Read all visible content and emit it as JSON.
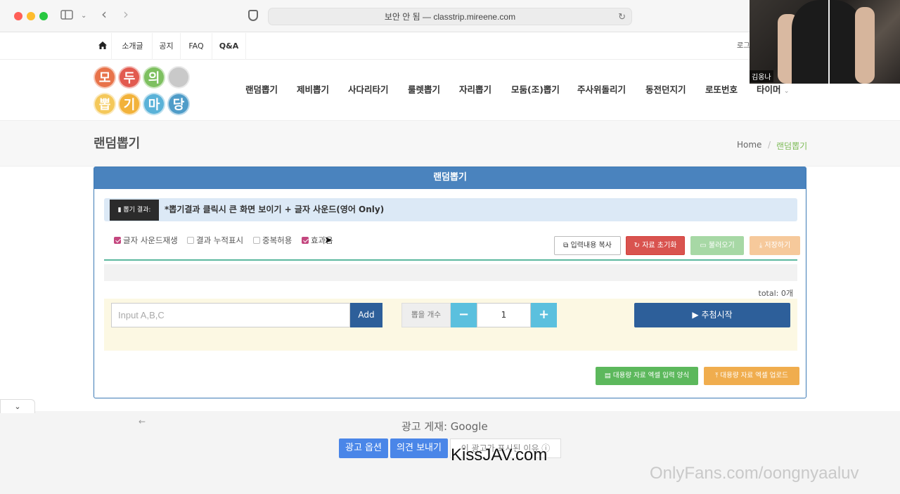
{
  "browser": {
    "url_text": "보안 안 됨 — classtrip.mireene.com",
    "sidebar_icon": "sidebar-icon",
    "back_icon": "‹",
    "forward_icon": "›",
    "reload_icon": "↻"
  },
  "webcam": {
    "name": "김옹나"
  },
  "topnav": {
    "items": [
      "소개글",
      "공지",
      "FAQ",
      "Q&A"
    ],
    "login": "로그"
  },
  "logo": {
    "chars": [
      "모",
      "두",
      "의",
      "",
      "뽑",
      "기",
      "마",
      "당"
    ]
  },
  "menu": {
    "items": [
      "랜덤뽑기",
      "제비뽑기",
      "사다리타기",
      "룰렛뽑기",
      "자리뽑기",
      "모둠(조)뽑기",
      "주사위돌리기",
      "동전던지기",
      "로또번호",
      "타이머"
    ]
  },
  "page": {
    "title": "랜덤뽑기",
    "breadcrumb_home": "Home",
    "breadcrumb_sep": "/",
    "breadcrumb_current": "랜덤뽑기"
  },
  "panel": {
    "heading": "랜덤뽑기",
    "result_tag": "뽑기 결과:",
    "result_text": "*뽑기결과 클릭시 큰 화면 보이기 + 글자 사운드(영어 Only)",
    "options": [
      {
        "label": "글자 사운드재생",
        "checked": true
      },
      {
        "label": "결과 누적표시",
        "checked": false
      },
      {
        "label": "중복허용",
        "checked": false
      },
      {
        "label": "효과음",
        "checked": true
      }
    ],
    "btn_copy": "입력내용 복사",
    "btn_reset": "자료 초기화",
    "btn_load": "불러오기",
    "btn_save": "저장하기",
    "total": "total: 0개",
    "input_placeholder": "Input A,B,C",
    "btn_add": "Add",
    "count_label": "뽑을 개수",
    "btn_minus": "−",
    "count_value": "1",
    "btn_plus": "+",
    "btn_start": "추첨시작",
    "btn_excel_form": "대용량 자료 엑셀 입력 양식",
    "btn_excel_upload": "대용량 자료 엑셀 업로드"
  },
  "ad": {
    "label": "광고 게재: Google",
    "btn_options": "광고 옵션",
    "btn_feedback": "의견 보내기",
    "btn_why": "이 광고가 표시된 이유 ⓘ"
  },
  "watermarks": {
    "kiss": "KissJAV.com",
    "of": "OnlyFans.com/oongnyaaluv"
  }
}
